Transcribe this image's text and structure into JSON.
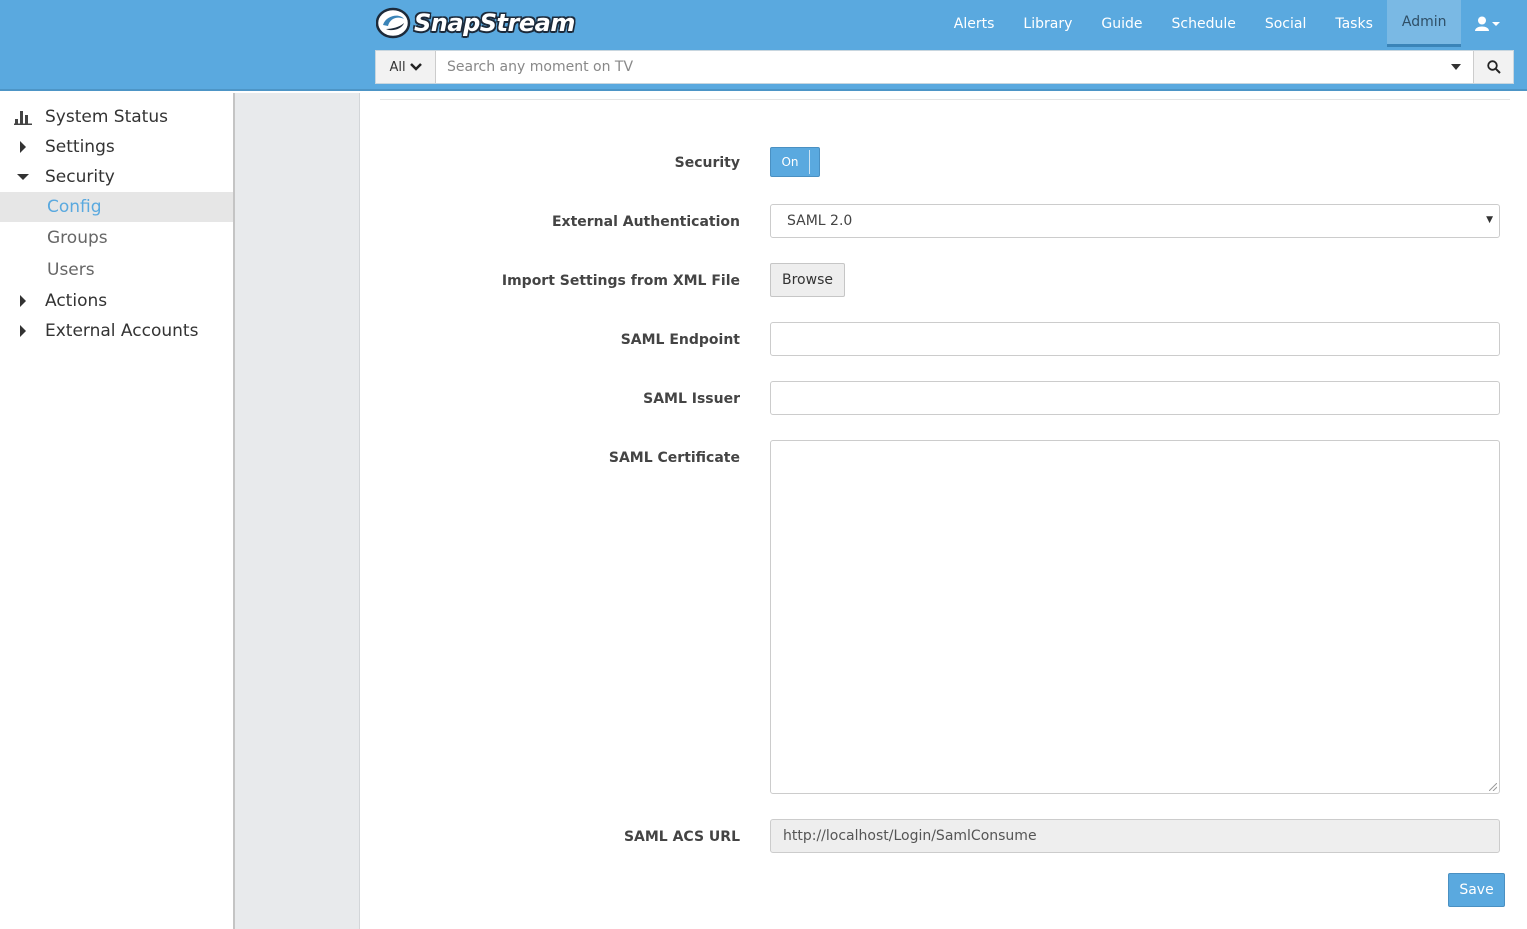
{
  "app": {
    "logo_text": "SnapStream"
  },
  "topnav": {
    "items": [
      {
        "label": "Alerts"
      },
      {
        "label": "Library"
      },
      {
        "label": "Guide"
      },
      {
        "label": "Schedule"
      },
      {
        "label": "Social"
      },
      {
        "label": "Tasks"
      },
      {
        "label": "Admin",
        "active": true
      }
    ],
    "user_icon": "user-icon"
  },
  "search": {
    "scope_label": "All",
    "placeholder": "Search any moment on TV",
    "value": ""
  },
  "sidebar": {
    "items": [
      {
        "label": "System Status",
        "icon": "bar-chart-icon"
      },
      {
        "label": "Settings",
        "icon": "caret-right-icon"
      },
      {
        "label": "Security",
        "icon": "caret-down-icon",
        "expanded": true
      },
      {
        "label": "Config",
        "selected": true
      },
      {
        "label": "Groups"
      },
      {
        "label": "Users"
      },
      {
        "label": "Actions",
        "icon": "caret-right-icon"
      },
      {
        "label": "External Accounts",
        "icon": "caret-right-icon"
      }
    ]
  },
  "form": {
    "security_label": "Security",
    "security_toggle": "On",
    "external_auth_label": "External Authentication",
    "external_auth_value": "SAML 2.0",
    "import_label": "Import Settings from XML File",
    "browse_label": "Browse",
    "endpoint_label": "SAML Endpoint",
    "endpoint_value": "",
    "issuer_label": "SAML Issuer",
    "issuer_value": "",
    "certificate_label": "SAML Certificate",
    "certificate_value": "",
    "acs_label": "SAML ACS URL",
    "acs_value": "http://localhost/Login/SamlConsume",
    "save_label": "Save"
  },
  "colors": {
    "header": "#5aa9df",
    "accent": "#5aa9df",
    "gutter": "#e8eaec"
  }
}
